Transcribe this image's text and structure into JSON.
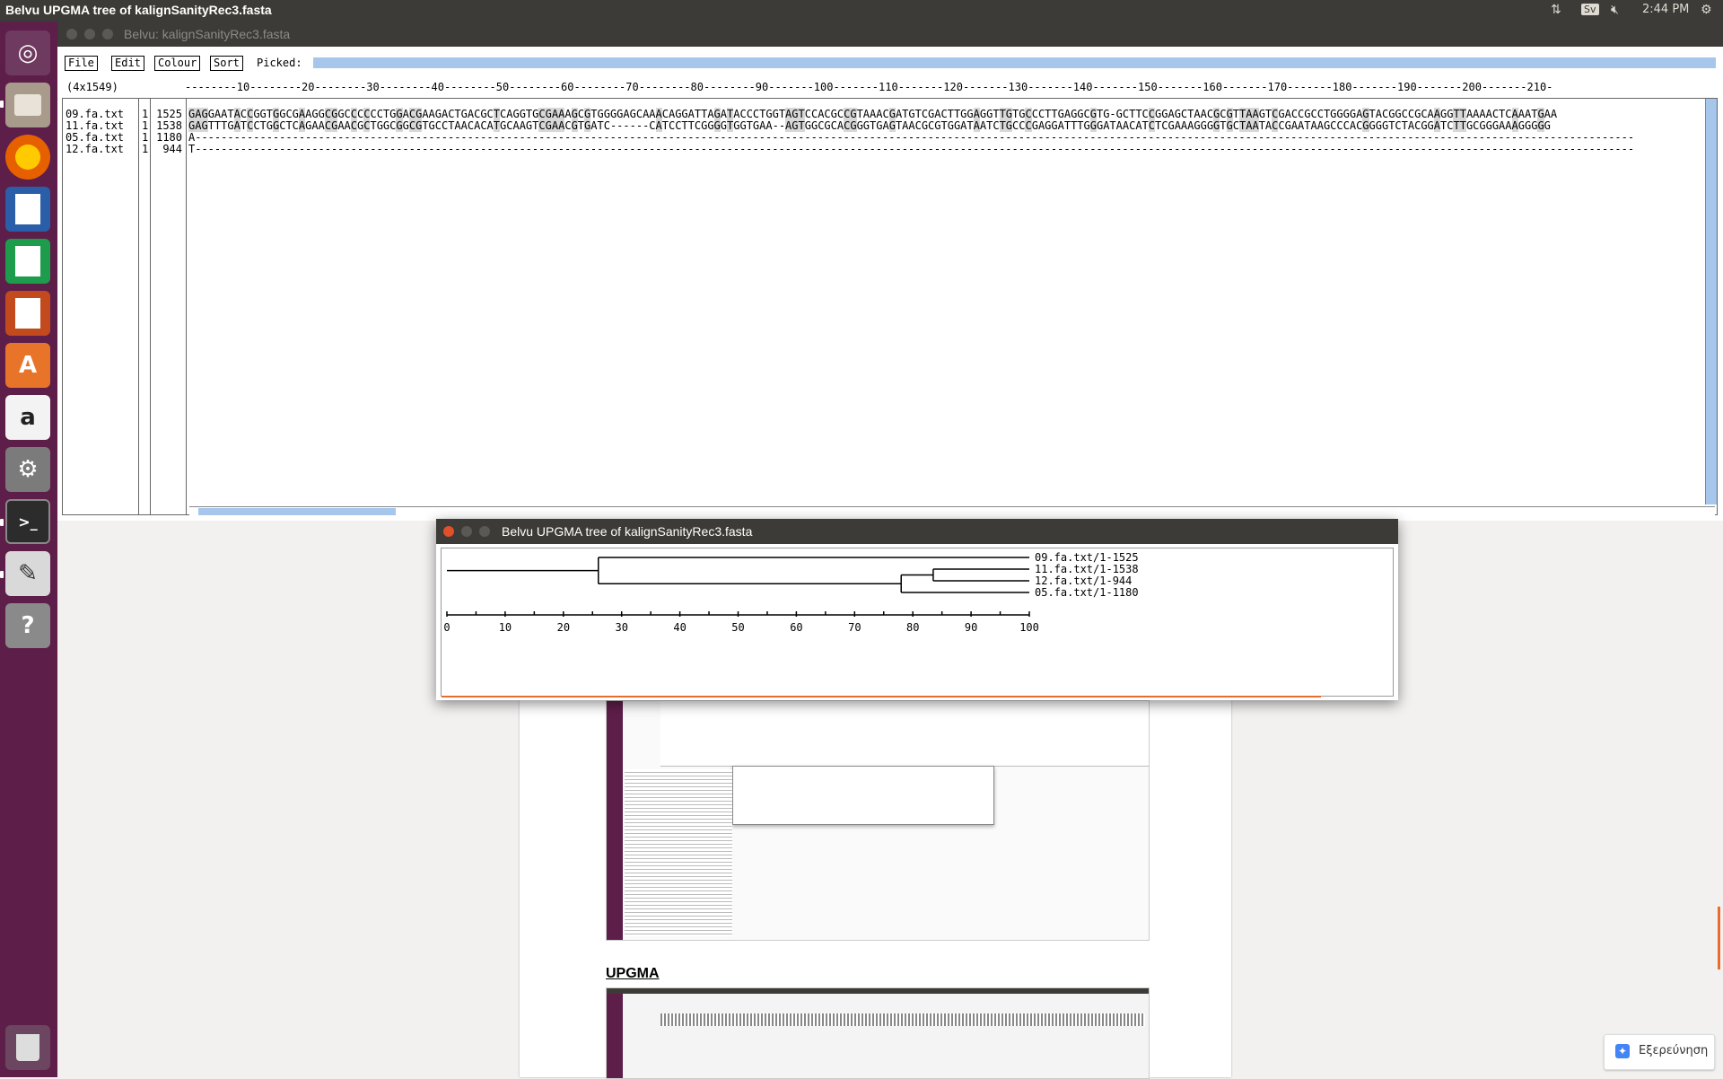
{
  "topbar": {
    "app_title": "Belvu UPGMA tree of kalignSanityRec3.fasta",
    "keyboard": "Sv",
    "clock": "2:44 PM"
  },
  "launcher": {
    "items": [
      "dash-icon",
      "files-icon",
      "firefox-icon",
      "writer-icon",
      "calc-icon",
      "impress-icon",
      "software-center-icon",
      "amazon-icon",
      "system-settings-icon",
      "terminal-icon",
      "text-editor-icon",
      "help-icon",
      "trash-icon"
    ]
  },
  "main_window": {
    "title": "Belvu:  kalignSanityRec3.fasta",
    "menu": {
      "file": "File",
      "edit": "Edit",
      "colour": "Colour",
      "sort": "Sort",
      "picked_label": "Picked:"
    },
    "coords": "(4x1549)",
    "ruler": "--------10--------20--------30--------40--------50--------60--------70--------80--------90-------100-------110-------120-------130-------140-------150-------160-------170-------180-------190-------200-------210-",
    "rows": [
      {
        "name": "09.fa.txt",
        "start": "1",
        "end": "1525",
        "seq": "GAGGAATACCGGTGGCGAAGGCGGCCCCCCTGGACGAAGACTGACGCTCAGGTGCGAAAGCGTGGGGAGCAAACAGGATTAGATACCCTGGTAGTCCACGCCGTAAACGATGTCGACTTGGAGGTTGTGCCCTTGAGGCGTG-GCTTCCGGAGCTAACGCGTTAAGTCGACCGCCTGGGGAGTACGGCCGCAAGGTTAAAACTCAAATGAA"
      },
      {
        "name": "11.fa.txt",
        "start": "1",
        "end": "1538",
        "seq": "GAGTTTGATCCTGGCTCAGAACGAACGCTGGCGGCGTGCCTAACACATGCAAGTCGAACGTGATC------CATCCTTCGGGGTGGTGAA--AGTGGCGCACGGGTGAGTAACGCGTGGATAATCTGCCCGAGGATTTGGGATAACATCTCGAAAGGGGTGCTAATACCGAATAAGCCCACGGGGTCTACGGATCTTGCGGGAAAGGGGG"
      },
      {
        "name": "05.fa.txt",
        "start": "1",
        "end": "1180",
        "seq": "A------------------------------------------------------------------------------------------------------------------------------------------------------------------------------------------------------------------------------"
      },
      {
        "name": "12.fa.txt",
        "start": "1",
        "end": "944",
        "seq": "T------------------------------------------------------------------------------------------------------------------------------------------------------------------------------------------------------------------------------"
      }
    ]
  },
  "tree_window": {
    "title": "Belvu UPGMA tree of kalignSanityRec3.fasta",
    "leaves": [
      "09.fa.txt/1-1525",
      "11.fa.txt/1-1538",
      "12.fa.txt/1-944",
      "05.fa.txt/1-1180"
    ],
    "scale_ticks": [
      "0",
      "10",
      "20",
      "30",
      "40",
      "50",
      "60",
      "70",
      "80",
      "90",
      "100"
    ],
    "tree": {
      "root_join": 26,
      "inner_join": 78,
      "leaf_pair_join": 83.5,
      "leaf_depth": 100
    }
  },
  "document": {
    "heading": "UPGMA"
  },
  "explore_button": {
    "label": "Εξερεύνηση"
  }
}
